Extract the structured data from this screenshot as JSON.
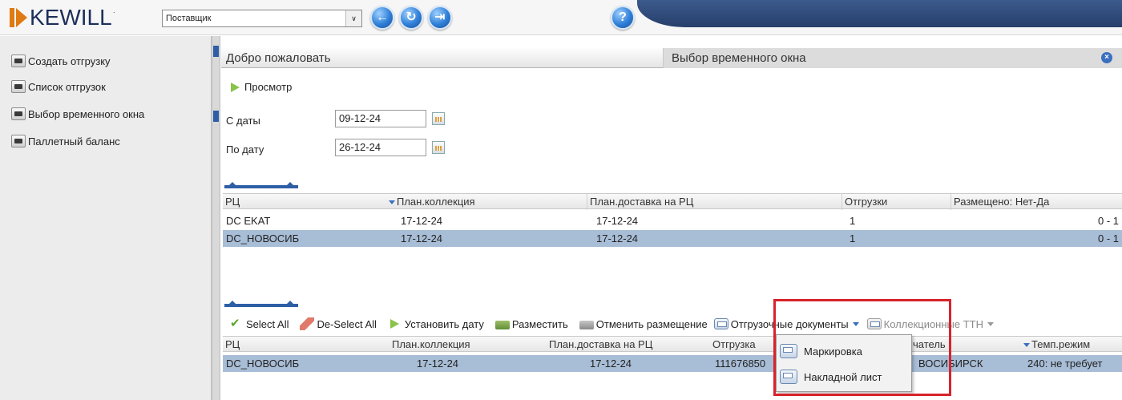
{
  "header": {
    "logo_text": "KEWILL",
    "logo_tm": "·",
    "supplier_select": "Поставщик",
    "supplier_arrow": "∨",
    "back_glyph": "←",
    "refresh_glyph": "↻",
    "exit_glyph": "⇥",
    "help_glyph": "?"
  },
  "sidebar": {
    "items": [
      {
        "label": "Создать отгрузку"
      },
      {
        "label": "Список отгрузок"
      },
      {
        "label": "Выбор временного окна"
      },
      {
        "label": "Паллетный баланс"
      }
    ]
  },
  "tabs": {
    "welcome": "Добро пожаловать",
    "time_window": "Выбор временного окна",
    "close_glyph": "×"
  },
  "view_button": "Просмотр",
  "filters": {
    "from_label": "С даты",
    "from_value": "09-12-24",
    "to_label": "По дату",
    "to_value": "26-12-24"
  },
  "grid1": {
    "columns": [
      "РЦ",
      "План.коллекция",
      "План.доставка на РЦ",
      "Отгрузки",
      "Размещено: Нет-Да"
    ],
    "rows": [
      {
        "rc": "DC EKAT",
        "plan_collection": "17-12-24",
        "plan_delivery": "17-12-24",
        "shipments": "1",
        "placed": "0 - 1",
        "selected": false
      },
      {
        "rc": "DC_НОВОСИБ",
        "plan_collection": "17-12-24",
        "plan_delivery": "17-12-24",
        "shipments": "1",
        "placed": "0 - 1",
        "selected": true
      }
    ]
  },
  "toolbar": {
    "select_all": "Select All",
    "deselect_all": "De-Select All",
    "set_date": "Установить дату",
    "place": "Разместить",
    "cancel_place": "Отменить размещение",
    "shipping_docs": "Отгрузочные документы",
    "collection_ttn": "Коллекционные ТТН"
  },
  "grid2": {
    "columns": [
      "РЦ",
      "План.коллекция",
      "План.доставка на РЦ",
      "Отгрузка",
      "чатель",
      "Темп.режим"
    ],
    "rows": [
      {
        "rc": "DC_НОВОСИБ",
        "plan_collection": "17-12-24",
        "plan_delivery": "17-12-24",
        "shipment": "111676850",
        "recipient": "ВОСИБИРСК",
        "temp": "240: не требует"
      }
    ]
  },
  "dropdown": {
    "items": [
      {
        "label": "Маркировка"
      },
      {
        "label": "Накладной лист"
      }
    ]
  },
  "colors": {
    "brand_orange": "#e07a12",
    "brand_navy": "#1d2f5a",
    "selection": "#a8bdd6",
    "highlight": "#d8232a"
  }
}
